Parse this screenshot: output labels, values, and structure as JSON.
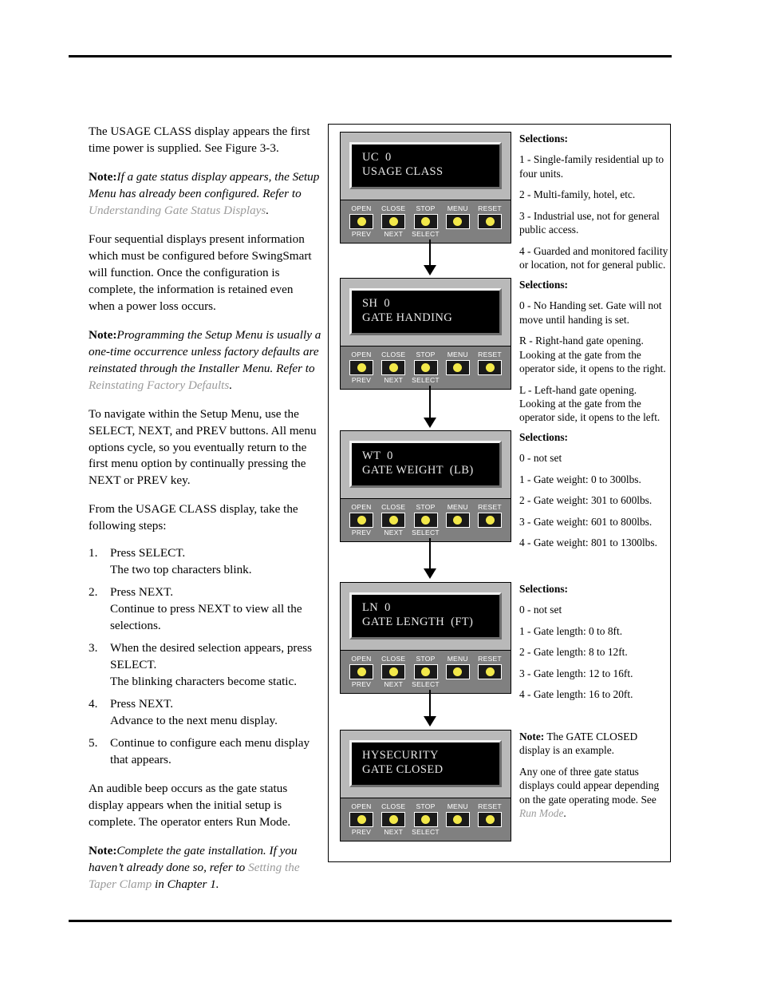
{
  "left_column": {
    "paragraphs": [
      {
        "kind": "plain",
        "text": "The USAGE CLASS display appears the first time power is supplied. See Figure 3-3."
      },
      {
        "kind": "note",
        "label": "Note:",
        "italic": "If a gate status display appears, the Setup Menu has already been configured. Refer to ",
        "xref": "Understanding Gate Status Displays",
        "tail": "."
      },
      {
        "kind": "plain",
        "text": "Four sequential displays present information which must be configured before SwingSmart will function. Once the configuration is complete, the information is retained even when a power loss occurs."
      },
      {
        "kind": "note",
        "label": "Note:",
        "italic": "Programming the Setup Menu is usually a one-time occurrence unless factory defaults are reinstated through the Installer Menu. Refer to ",
        "xref": "Reinstating Factory Defaults",
        "tail": "."
      },
      {
        "kind": "plain",
        "text": "To navigate within the Setup Menu, use the SELECT, NEXT, and PREV buttons. All menu options cycle, so you eventually return to the first menu option by continually pressing the NEXT or PREV key."
      },
      {
        "kind": "plain",
        "text": "From the USAGE CLASS display, take the following steps:"
      }
    ],
    "steps": [
      {
        "num": "1.",
        "lines": [
          "Press SELECT.",
          "The two top characters blink."
        ]
      },
      {
        "num": "2.",
        "lines": [
          "Press NEXT.",
          "Continue to press NEXT to view all the selections."
        ]
      },
      {
        "num": "3.",
        "lines": [
          "When the desired selection appears, press SELECT.",
          "The blinking characters become static."
        ]
      },
      {
        "num": "4.",
        "lines": [
          "Press NEXT.",
          "Advance to the next menu display."
        ]
      },
      {
        "num": "5.",
        "lines": [
          "Continue to configure each menu display that appears."
        ]
      }
    ],
    "closing_paragraphs": [
      {
        "kind": "plain",
        "text": "An audible beep occurs as the gate status display appears when the initial setup is complete. The operator enters Run Mode."
      },
      {
        "kind": "note",
        "label": "Note:",
        "italic": "Complete the gate installation. If you haven’t already done so, refer to ",
        "xref": "Setting the Taper Clamp",
        "tail": " in Chapter 1."
      }
    ]
  },
  "figure": {
    "keypad": {
      "keys": [
        {
          "top": "OPEN",
          "bottom": "PREV"
        },
        {
          "top": "CLOSE",
          "bottom": "NEXT"
        },
        {
          "top": "STOP",
          "bottom": "SELECT"
        },
        {
          "top": "MENU",
          "bottom": ""
        },
        {
          "top": "RESET",
          "bottom": ""
        }
      ],
      "led_color": "#f2e84a",
      "panel_top_color": "#b9b9b9",
      "panel_keypad_color": "#808080"
    },
    "stages": [
      {
        "lcd": {
          "line1": "UC  0",
          "line2": "USAGE CLASS"
        },
        "side": {
          "heading": "Selections:",
          "items": [
            "1 - Single-family residential up to four units.",
            "2 - Multi-family, hotel, etc.",
            "3 - Industrial use, not for general public access.",
            "4 - Guarded and monitored facility or location, not for general public."
          ]
        }
      },
      {
        "lcd": {
          "line1": "SH  0",
          "line2": "GATE HANDING"
        },
        "side": {
          "heading": "Selections:",
          "items": [
            "0 - No Handing set. Gate will not move until handing is set.",
            "R - Right-hand gate opening. Looking at the gate from the operator side, it opens to the right.",
            "L - Left-hand gate opening. Looking at the gate from the operator side, it opens to the left."
          ]
        }
      },
      {
        "lcd": {
          "line1": "WT  0",
          "line2": "GATE WEIGHT  (LB)"
        },
        "side": {
          "heading": "Selections:",
          "items": [
            "0 - not set",
            "1 - Gate weight: 0 to 300lbs.",
            "2 - Gate weight: 301 to 600lbs.",
            "3 - Gate weight: 601 to 800lbs.",
            "4 - Gate weight: 801 to 1300lbs."
          ]
        }
      },
      {
        "lcd": {
          "line1": "LN  0",
          "line2": "GATE LENGTH  (FT)"
        },
        "side": {
          "heading": "Selections:",
          "items": [
            "0 - not set",
            "1 - Gate length: 0 to 8ft.",
            "2 - Gate length: 8 to 12ft.",
            "3 - Gate length: 12 to 16ft.",
            "4 - Gate length: 16 to 20ft."
          ]
        }
      },
      {
        "lcd": {
          "line1": "HYSECURITY",
          "line2": "GATE CLOSED"
        },
        "side": {
          "note_label": "Note:",
          "note_text": " The GATE CLOSED display is an example.",
          "body": "Any one of three gate status displays could appear depending on the gate operating mode. See ",
          "xref": "Run Mode",
          "tail": "."
        }
      }
    ]
  }
}
